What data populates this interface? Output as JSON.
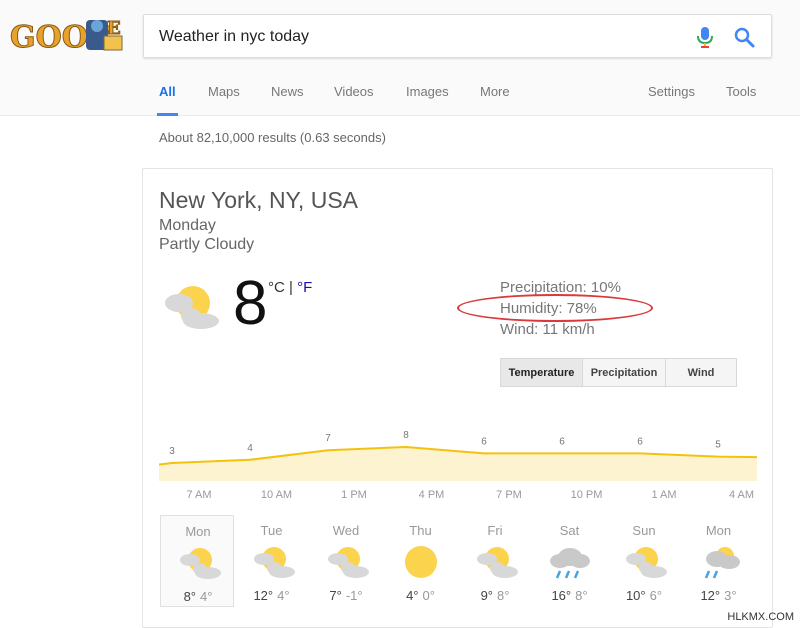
{
  "search": {
    "query": "Weather in nyc today"
  },
  "tabs": {
    "left": [
      "All",
      "Maps",
      "News",
      "Videos",
      "Images",
      "More"
    ],
    "right": [
      "Settings",
      "Tools"
    ]
  },
  "result_stats": "About 82,10,000 results (0.63 seconds)",
  "weather": {
    "location": "New York, NY, USA",
    "day": "Monday",
    "condition": "Partly Cloudy",
    "temperature": "8",
    "unit_c": "°C",
    "unit_sep": " | ",
    "unit_f": "°F",
    "precipitation": "Precipitation: 10%",
    "humidity": "Humidity: 78%",
    "wind": "Wind: 11 km/h",
    "toggles": [
      "Temperature",
      "Precipitation",
      "Wind"
    ],
    "active_toggle": "Temperature",
    "colors": {
      "chart_line": "#f4c20d",
      "chart_fill": "#fdf3d0",
      "sun": "#fcd34d",
      "cloud": "#d8d8d8",
      "rain": "#4aa3df"
    }
  },
  "chart_data": {
    "type": "area",
    "x": [
      "7 AM",
      "10 AM",
      "1 PM",
      "4 PM",
      "7 PM",
      "10 PM",
      "1 AM",
      "4 AM"
    ],
    "values": [
      3,
      4,
      7,
      8,
      6,
      6,
      6,
      5
    ],
    "data_labels": [
      "3",
      "4",
      "7",
      "8",
      "6",
      "6",
      "6",
      "5"
    ]
  },
  "forecast": [
    {
      "day": "Mon",
      "hi": "8°",
      "lo": "4°",
      "icon": "partly-cloudy-icon"
    },
    {
      "day": "Tue",
      "hi": "12°",
      "lo": "4°",
      "icon": "partly-cloudy-icon"
    },
    {
      "day": "Wed",
      "hi": "7°",
      "lo": "-1°",
      "icon": "partly-cloudy-icon"
    },
    {
      "day": "Thu",
      "hi": "4°",
      "lo": "0°",
      "icon": "sunny-icon"
    },
    {
      "day": "Fri",
      "hi": "9°",
      "lo": "8°",
      "icon": "partly-cloudy-icon"
    },
    {
      "day": "Sat",
      "hi": "16°",
      "lo": "8°",
      "icon": "rain-icon"
    },
    {
      "day": "Sun",
      "hi": "10°",
      "lo": "6°",
      "icon": "partly-cloudy-icon"
    },
    {
      "day": "Mon",
      "hi": "12°",
      "lo": "3°",
      "icon": "showers-icon"
    }
  ],
  "watermark": "HLKMX.COM"
}
